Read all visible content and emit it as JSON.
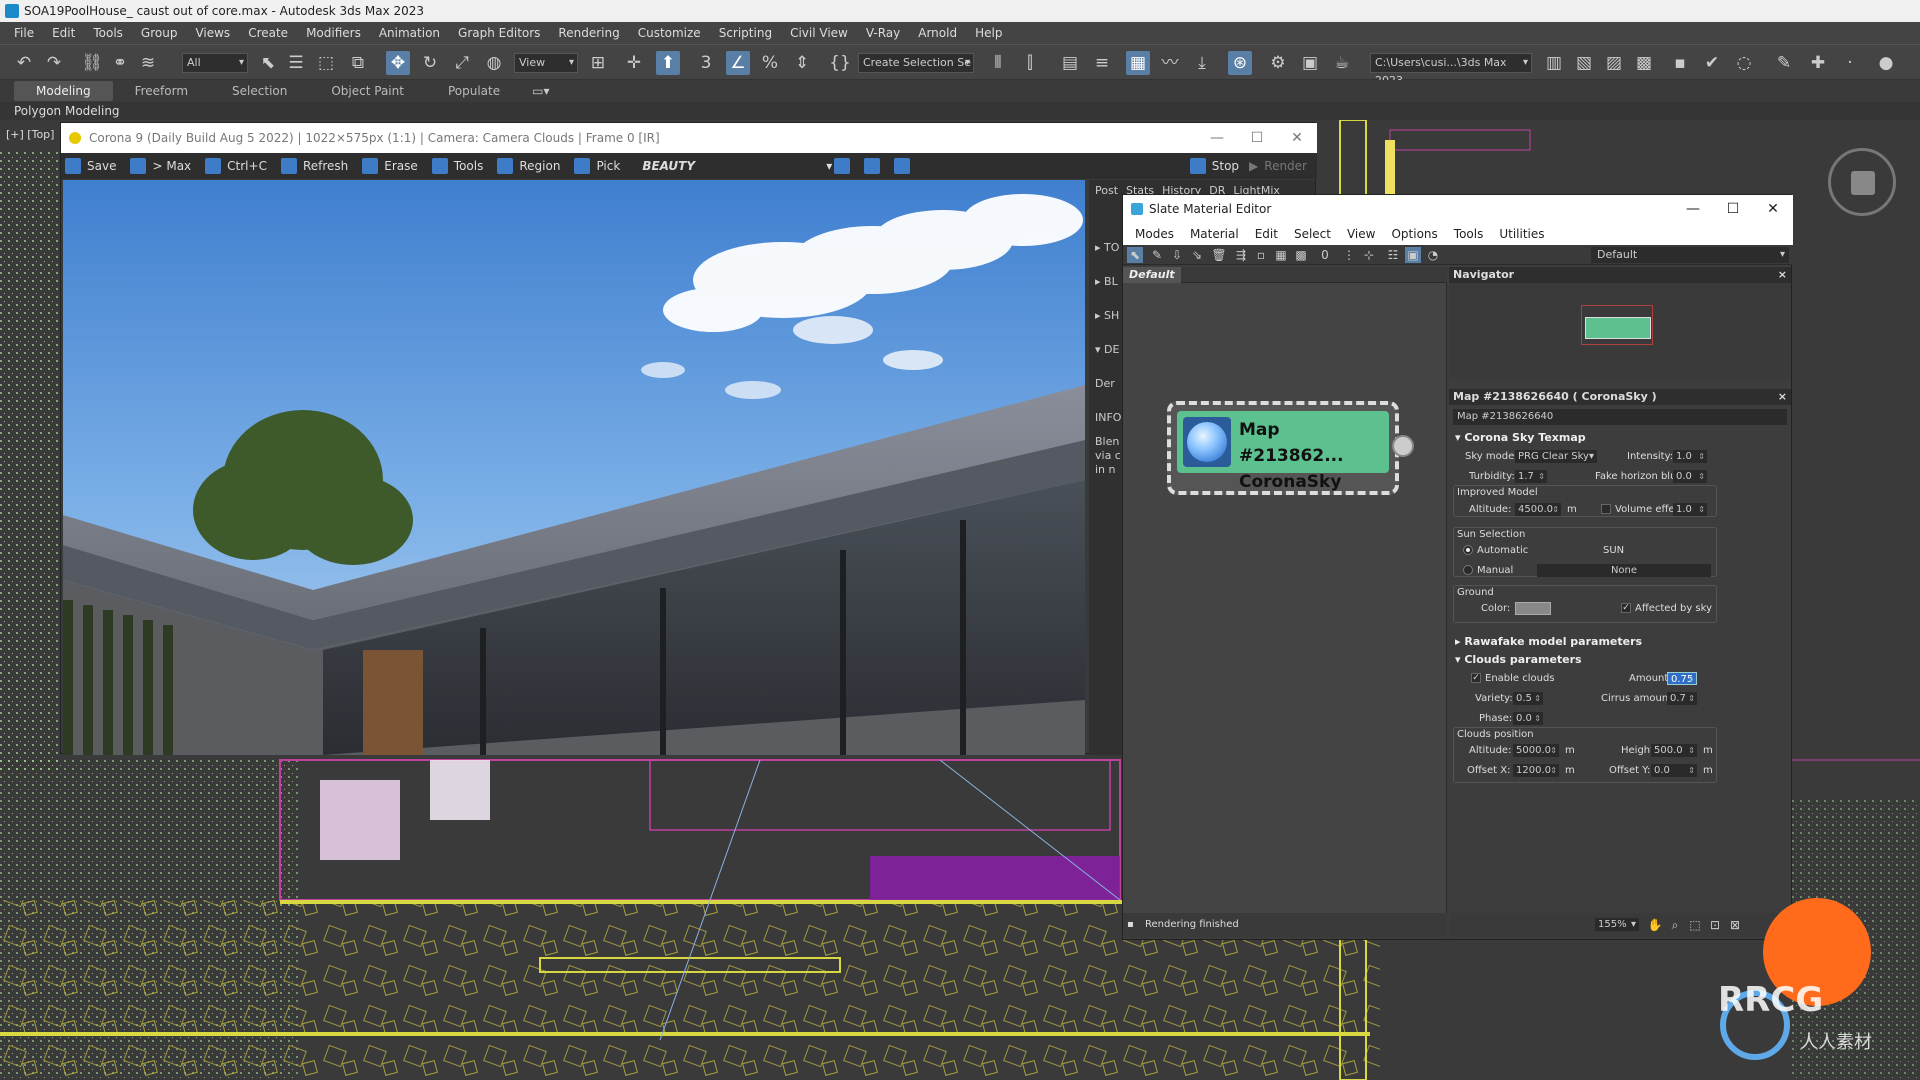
{
  "titlebar": {
    "title": "SOA19PoolHouse_ caust out of core.max - Autodesk 3ds Max 2023"
  },
  "menu": [
    "File",
    "Edit",
    "Tools",
    "Group",
    "Views",
    "Create",
    "Modifiers",
    "Animation",
    "Graph Editors",
    "Rendering",
    "Customize",
    "Scripting",
    "Civil View",
    "V-Ray",
    "Arnold",
    "Help"
  ],
  "toolbar": {
    "filter_value": "All",
    "view_value": "View",
    "selection_set": "Create Selection Se",
    "project_path": "C:\\Users\\cusi...\\3ds Max 2023"
  },
  "ribbon": {
    "tabs": [
      "Modeling",
      "Freeform",
      "Selection",
      "Object Paint",
      "Populate"
    ],
    "active": "Modeling",
    "sub": "Polygon Modeling"
  },
  "viewport": {
    "label": "[+] [Top]"
  },
  "vfb": {
    "title": "Corona 9 (Daily Build Aug  5 2022) | 1022×575px (1:1) | Camera: Camera Clouds | Frame 0 [IR]",
    "buttons": {
      "save": "Save",
      "max": "> Max",
      "copy": "Ctrl+C",
      "refresh": "Refresh",
      "erase": "Erase",
      "tools": "Tools",
      "region": "Region",
      "pick": "Pick"
    },
    "channel": "BEAUTY",
    "stop": "Stop",
    "render": "Render",
    "side_tabs": [
      "Post",
      "Stats",
      "History",
      "DR",
      "LightMix"
    ],
    "side_items": [
      "TO",
      "BL",
      "SH",
      "DE",
      "Der",
      "INFO",
      "Blen",
      "via c",
      "in n"
    ]
  },
  "slate": {
    "title": "Slate Material Editor",
    "menu": [
      "Modes",
      "Material",
      "Edit",
      "Select",
      "View",
      "Options",
      "Tools",
      "Utilities"
    ],
    "view_dropdown": "Default",
    "view_tab": "Default",
    "node": {
      "line1": "Map #213862...",
      "line2": "CoronaSky"
    },
    "status": "Rendering finished",
    "zoom": "155%",
    "navigator_title": "Navigator",
    "param_title": "Map #2138626640  ( CoronaSky )",
    "param_name": "Map #2138626640",
    "sky": {
      "section": "Corona Sky Texmap",
      "sky_model_label": "Sky model:",
      "sky_model": "PRG Clear Sky",
      "intensity_label": "Intensity:",
      "intensity": "1.0",
      "turbidity_label": "Turbidity:",
      "turbidity": "1.7",
      "horizon_blur_label": "Fake horizon blur:",
      "horizon_blur": "0.0",
      "improved_label": "Improved Model",
      "altitude_label": "Altitude:",
      "altitude": "4500.0",
      "altitude_unit": "m",
      "volume_label": "Volume effect",
      "volume": "1.0",
      "sun_selection_label": "Sun Selection",
      "automatic_label": "Automatic",
      "sun_value": "SUN",
      "manual_label": "Manual",
      "manual_value": "None",
      "ground_label": "Ground",
      "color_label": "Color:",
      "affected_label": "Affected by sky"
    },
    "rawafake_section": "Rawafake model parameters",
    "clouds": {
      "section": "Clouds parameters",
      "enable_label": "Enable clouds",
      "amount_label": "Amount:",
      "amount": "0.75",
      "variety_label": "Variety:",
      "variety": "0.5",
      "cirrus_label": "Cirrus amount:",
      "cirrus": "0.7",
      "phase_label": "Phase:",
      "phase": "0.0",
      "position_label": "Clouds position",
      "altitude_label": "Altitude:",
      "altitude": "5000.0",
      "altitude_unit": "m",
      "height_label": "Height:",
      "height": "500.0",
      "height_unit": "m",
      "offx_label": "Offset X:",
      "offx": "1200.0",
      "offx_unit": "m",
      "offy_label": "Offset Y:",
      "offy": "0.0",
      "offy_unit": "m"
    }
  },
  "watermark": {
    "logo": "RRCG",
    "sub": "人人素材"
  },
  "colors": {
    "node_green": "#5dc08f",
    "accent_blue": "#3f7cc8",
    "orange": "#ff6b1a"
  }
}
